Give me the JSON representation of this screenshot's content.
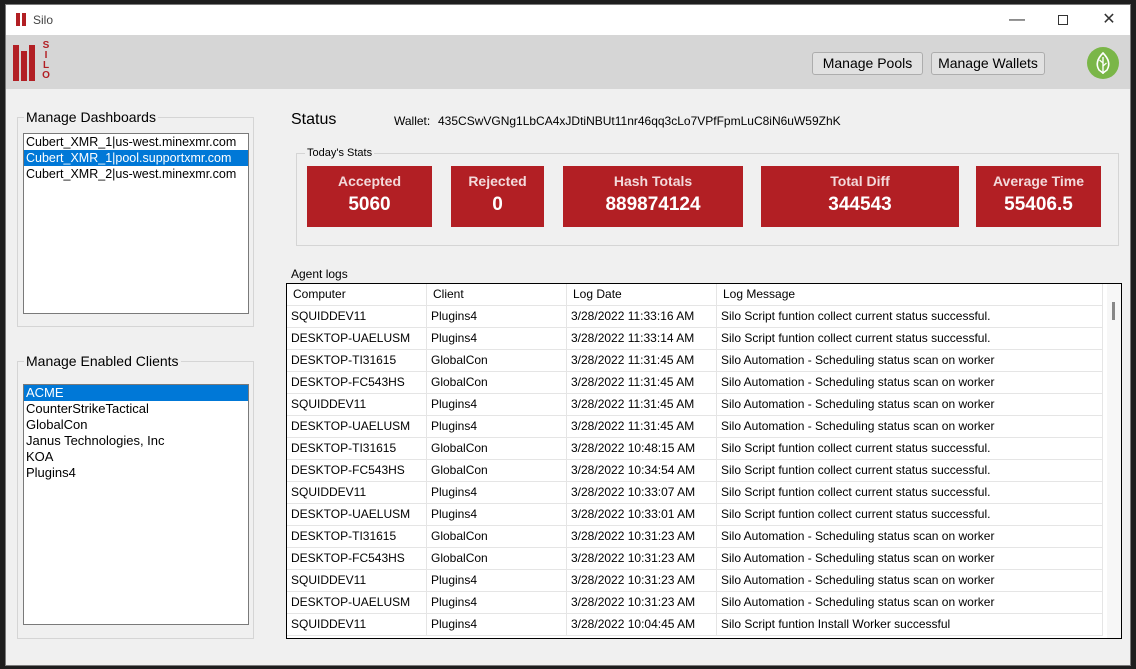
{
  "window": {
    "title": "Silo"
  },
  "header": {
    "logo_text": "SILO",
    "manage_pools_label": "Manage Pools",
    "manage_wallets_label": "Manage Wallets"
  },
  "dashboards": {
    "label": "Manage Dashboards",
    "items": [
      "Cubert_XMR_1|us-west.minexmr.com",
      "Cubert_XMR_1|pool.supportxmr.com",
      "Cubert_XMR_2|us-west.minexmr.com"
    ],
    "selected_index": 1
  },
  "clients": {
    "label": "Manage Enabled Clients",
    "items": [
      "ACME",
      "CounterStrikeTactical",
      "GlobalCon",
      "Janus Technologies, Inc",
      "KOA",
      "Plugins4"
    ],
    "selected_index": 0
  },
  "status": {
    "title": "Status",
    "wallet_label": "Wallet:",
    "wallet_value": "435CSwVGNg1LbCA4xJDtiNBUt11nr46qq3cLo7VPfFpmLuC8iN6uW59ZhK"
  },
  "stats": {
    "label": "Today's Stats",
    "accepted": {
      "label": "Accepted",
      "value": "5060"
    },
    "rejected": {
      "label": "Rejected",
      "value": "0"
    },
    "hash_totals": {
      "label": "Hash Totals",
      "value": "889874124"
    },
    "total_diff": {
      "label": "Total Diff",
      "value": "344543"
    },
    "average_time": {
      "label": "Average Time",
      "value": "55406.5"
    }
  },
  "logs": {
    "label": "Agent logs",
    "columns": [
      "Computer",
      "Client",
      "Log Date",
      "Log Message"
    ],
    "rows": [
      [
        "SQUIDDEV11",
        "Plugins4",
        "3/28/2022 11:33:16 AM",
        "Silo Script funtion collect current status successful."
      ],
      [
        "DESKTOP-UAELUSM",
        "Plugins4",
        "3/28/2022 11:33:14 AM",
        "Silo Script funtion collect current status successful."
      ],
      [
        "DESKTOP-TI31615",
        "GlobalCon",
        "3/28/2022 11:31:45 AM",
        "Silo Automation - Scheduling status scan on worker"
      ],
      [
        "DESKTOP-FC543HS",
        "GlobalCon",
        "3/28/2022 11:31:45 AM",
        "Silo Automation - Scheduling status scan on worker"
      ],
      [
        "SQUIDDEV11",
        "Plugins4",
        "3/28/2022 11:31:45 AM",
        "Silo Automation - Scheduling status scan on worker"
      ],
      [
        "DESKTOP-UAELUSM",
        "Plugins4",
        "3/28/2022 11:31:45 AM",
        "Silo Automation - Scheduling status scan on worker"
      ],
      [
        "DESKTOP-TI31615",
        "GlobalCon",
        "3/28/2022 10:48:15 AM",
        "Silo Script funtion collect current status successful."
      ],
      [
        "DESKTOP-FC543HS",
        "GlobalCon",
        "3/28/2022 10:34:54 AM",
        "Silo Script funtion collect current status successful."
      ],
      [
        "SQUIDDEV11",
        "Plugins4",
        "3/28/2022 10:33:07 AM",
        "Silo Script funtion collect current status successful."
      ],
      [
        "DESKTOP-UAELUSM",
        "Plugins4",
        "3/28/2022 10:33:01 AM",
        "Silo Script funtion collect current status successful."
      ],
      [
        "DESKTOP-TI31615",
        "GlobalCon",
        "3/28/2022 10:31:23 AM",
        "Silo Automation - Scheduling status scan on worker"
      ],
      [
        "DESKTOP-FC543HS",
        "GlobalCon",
        "3/28/2022 10:31:23 AM",
        "Silo Automation - Scheduling status scan on worker"
      ],
      [
        "SQUIDDEV11",
        "Plugins4",
        "3/28/2022 10:31:23 AM",
        "Silo Automation - Scheduling status scan on worker"
      ],
      [
        "DESKTOP-UAELUSM",
        "Plugins4",
        "3/28/2022 10:31:23 AM",
        "Silo Automation - Scheduling status scan on worker"
      ],
      [
        "SQUIDDEV11",
        "Plugins4",
        "3/28/2022 10:04:45 AM",
        "Silo Script funtion Install Worker successful"
      ]
    ]
  },
  "colors": {
    "brand_red": "#b21f24",
    "selection_blue": "#0078d7",
    "leaf_green": "#7ab648"
  },
  "icons": {
    "app": "silo-app-icon",
    "profile": "leaf-icon",
    "minimize": "minimize-icon",
    "maximize": "maximize-icon",
    "close": "close-icon"
  }
}
